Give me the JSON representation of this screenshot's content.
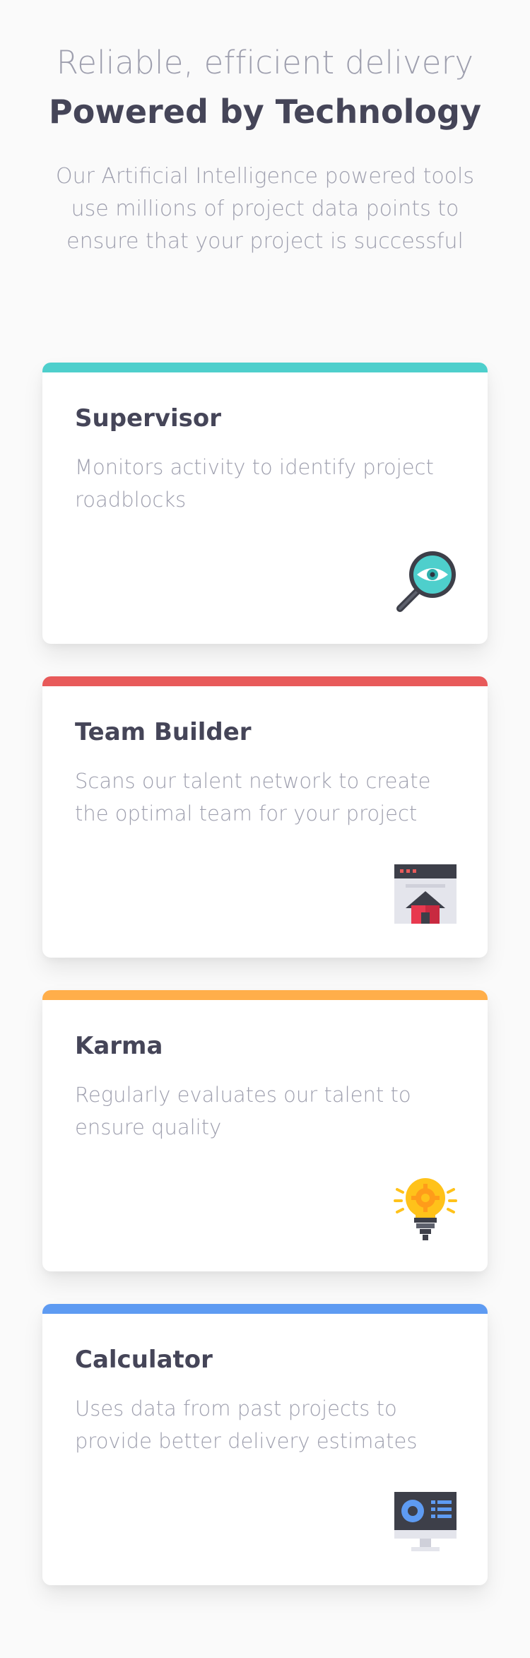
{
  "header": {
    "tagline": "Reliable, efficient delivery",
    "title": "Powered by Technology",
    "intro": "Our Artificial Intelligence powered tools use millions of project data points to ensure that your project is successful"
  },
  "colors": {
    "supervisor": "#4ecfcc",
    "team_builder": "#e85a5a",
    "karma": "#ffae4a",
    "calculator": "#5e9bf2"
  },
  "cards": [
    {
      "title": "Supervisor",
      "description": "Monitors activity to identify project roadblocks",
      "icon": "magnifier-eye-icon"
    },
    {
      "title": "Team Builder",
      "description": "Scans our talent network to create the optimal team for your project",
      "icon": "browser-house-icon"
    },
    {
      "title": "Karma",
      "description": "Regularly evaluates our talent to ensure quality",
      "icon": "lightbulb-gear-icon"
    },
    {
      "title": "Calculator",
      "description": "Uses data from past projects to provide better delivery estimates",
      "icon": "monitor-dashboard-icon"
    }
  ]
}
